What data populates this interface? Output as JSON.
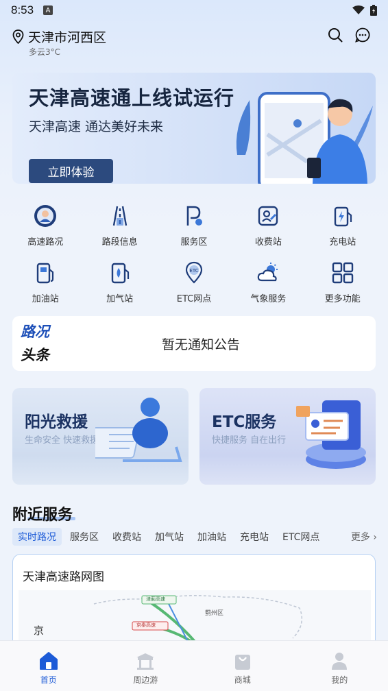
{
  "status_bar": {
    "time": "8:53",
    "notif_letter": "A"
  },
  "header": {
    "location": "天津市河西区",
    "weather": "多云3°C"
  },
  "banner": {
    "title": "天津高速通上线试运行",
    "subtitle": "天津高速 通达美好未来",
    "button": "立即体验"
  },
  "services": [
    {
      "label": "高速路况",
      "icon": "traffic-avatar-icon"
    },
    {
      "label": "路段信息",
      "icon": "road-icon"
    },
    {
      "label": "服务区",
      "icon": "parking-icon"
    },
    {
      "label": "收费站",
      "icon": "toll-icon"
    },
    {
      "label": "充电站",
      "icon": "charging-icon"
    },
    {
      "label": "加油站",
      "icon": "fuel-icon"
    },
    {
      "label": "加气站",
      "icon": "gas-icon"
    },
    {
      "label": "ETC网点",
      "icon": "etc-icon"
    },
    {
      "label": "气象服务",
      "icon": "weather-icon"
    },
    {
      "label": "更多功能",
      "icon": "grid-icon"
    }
  ],
  "notice": {
    "badge_top": "路况",
    "badge_bottom": "头条",
    "text": "暂无通知公告"
  },
  "cards": [
    {
      "title": "阳光救援",
      "subtitle": "生命安全 快速救援"
    },
    {
      "title": "ETC服务",
      "subtitle": "快捷服务 自在出行"
    }
  ],
  "nearby": {
    "title": "附近服务",
    "tabs": [
      "实时路况",
      "服务区",
      "收费站",
      "加气站",
      "加油站",
      "充电站",
      "ETC网点"
    ],
    "more": "更多",
    "map_title": "天津高速路网图",
    "map_labels": [
      "京",
      "蓟州区",
      "津蓟高速",
      "京秦高速"
    ]
  },
  "bottom_nav": [
    "首页",
    "周边游",
    "商城",
    "我的"
  ],
  "colors": {
    "accent": "#1d5bd7",
    "brand_dark": "#2c4a7e"
  }
}
